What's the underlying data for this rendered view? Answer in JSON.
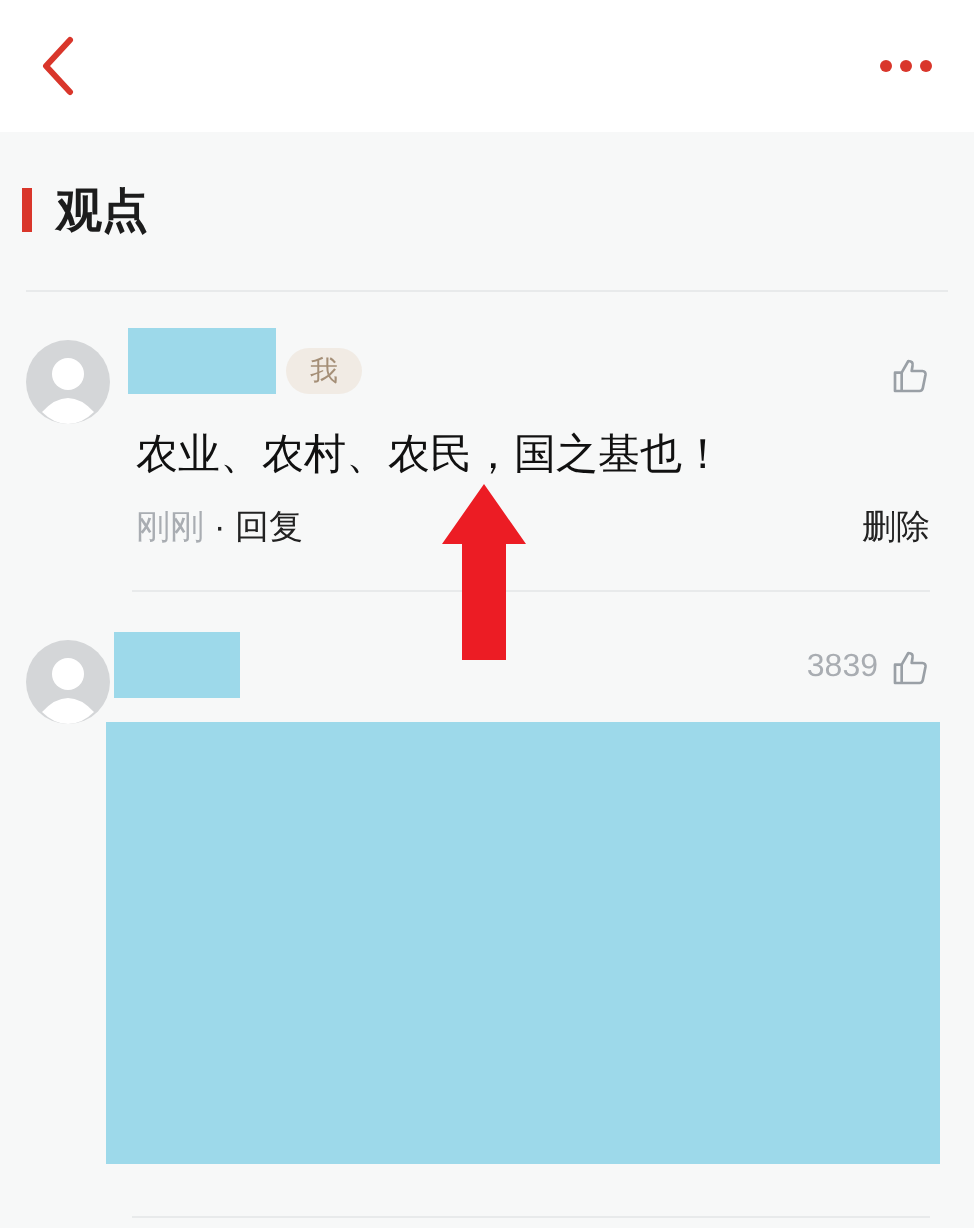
{
  "header": {
    "back": true,
    "more": true
  },
  "section": {
    "title": "观点"
  },
  "comments": [
    {
      "name_redacted": true,
      "badge": "我",
      "text": "农业、农村、农民，国之基也！",
      "time": "刚刚",
      "separator": "·",
      "reply": "回复",
      "delete": "删除"
    },
    {
      "name_redacted": true,
      "likes": "3839",
      "content_redacted": true
    }
  ],
  "annotation": {
    "kind": "arrow"
  }
}
